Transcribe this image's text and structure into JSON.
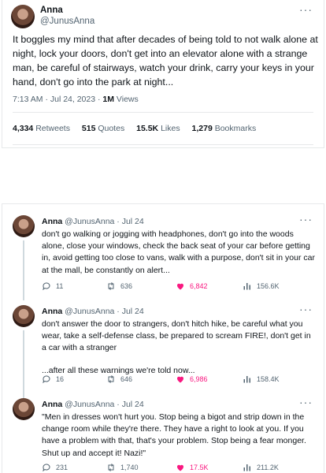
{
  "main_tweet": {
    "name": "Anna",
    "handle": "@JunusAnna",
    "text": "It boggles my mind that after decades of being told to not walk alone at night, lock your doors, don't get into an elevator alone with a strange man, be careful of stairways, watch your drink, carry your keys in your hand, don't go into the park at night...",
    "time": "7:13 AM · Jul 24, 2023 · ",
    "views_count": "1M",
    "views_label": " Views",
    "retweets_count": "4,334",
    "retweets_label": " Retweets",
    "quotes_count": "515",
    "quotes_label": " Quotes",
    "likes_count": "15.5K",
    "likes_label": " Likes",
    "bookmarks_count": "1,279",
    "bookmarks_label": " Bookmarks"
  },
  "more_glyph": "···",
  "replies": [
    {
      "name": "Anna",
      "handle_date": " @JunusAnna · Jul 24",
      "paragraphs": [
        "don't go walking or jogging with headphones, don't go into the woods alone, close your windows, check the back seat of your car before getting in, avoid getting too close to vans, walk with a purpose, don't sit in your car at the mall, be constantly on alert..."
      ],
      "replies": "11",
      "retweets": "636",
      "likes": "6,842",
      "views": "156.6K"
    },
    {
      "name": "Anna",
      "handle_date": " @JunusAnna · Jul 24",
      "paragraphs": [
        "don't answer the door to strangers, don't hitch hike, be careful what you wear, take a self-defense class, be prepared to scream FIRE!, don't get in a car with a stranger",
        "...after all these warnings we're told now..."
      ],
      "replies": "16",
      "retweets": "646",
      "likes": "6,986",
      "views": "158.4K"
    },
    {
      "name": "Anna",
      "handle_date": " @JunusAnna · Jul 24",
      "paragraphs": [
        "\"Men in dresses won't hurt you. Stop being a bigot and strip down in the change room while they're there. They have a right to look at you. If you have a problem with that, that's your problem. Stop being a fear monger. Shut up and accept it! Nazi!\""
      ],
      "replies": "231",
      "retweets": "1,740",
      "likes": "17.5K",
      "views": "211.2K"
    }
  ],
  "colors": {
    "like": "#f91880",
    "muted": "#536471",
    "text": "#0f1419",
    "border": "#e7e9ea"
  },
  "icons": [
    "reply-icon",
    "retweet-icon",
    "heart-icon",
    "views-icon",
    "more-icon"
  ]
}
